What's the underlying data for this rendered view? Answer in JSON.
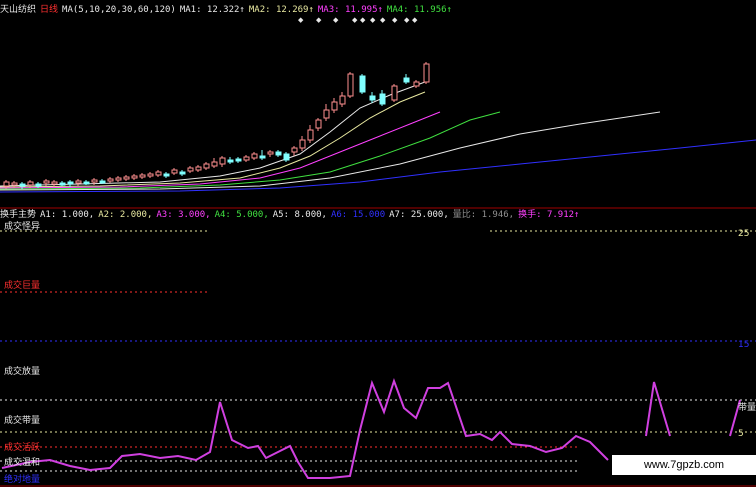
{
  "colors": {
    "background": "#000000",
    "white": "#e8e8e8",
    "yellow": "#e8e8a0",
    "magenta": "#ff40ff",
    "green": "#40e040",
    "blue": "#3030ff",
    "red": "#ff3030",
    "cyan": "#80ffff",
    "salmon": "#ff9090",
    "gray": "#909090",
    "turnover_line": "#d040e0"
  },
  "header": {
    "stock_name": "天山纺织",
    "period": "日线",
    "ma_params": "MA(5,10,20,30,60,120)",
    "ma1": "MA1: 12.322↑",
    "ma2": "MA2: 12.269↑",
    "ma3": "MA3: 11.995↑",
    "ma4": "MA4: 11.956↑"
  },
  "indicator_header": {
    "name": "换手主势",
    "a1": "A1: 1.000,",
    "a2": "A2: 2.000,",
    "a3": "A3: 3.000,",
    "a4": "A4: 5.000,",
    "a5": "A5: 8.000,",
    "a6": "A6: 15.000",
    "a7": "A7: 25.000,",
    "volume_ratio": "量比: 1.946,",
    "turnover": "换手: 7.912↑"
  },
  "zone_labels": {
    "abnormal": "成交怪异",
    "huge": "成交巨量",
    "heavy": "成交放量",
    "medium": "成交带量",
    "active": "成交活跃",
    "mild": "成交温和",
    "low": "绝对地量"
  },
  "right_labels": {
    "level_25": "25",
    "level_15": "15",
    "band": "带量",
    "level_5": "5"
  },
  "watermark": "www.7gpzb.com"
}
